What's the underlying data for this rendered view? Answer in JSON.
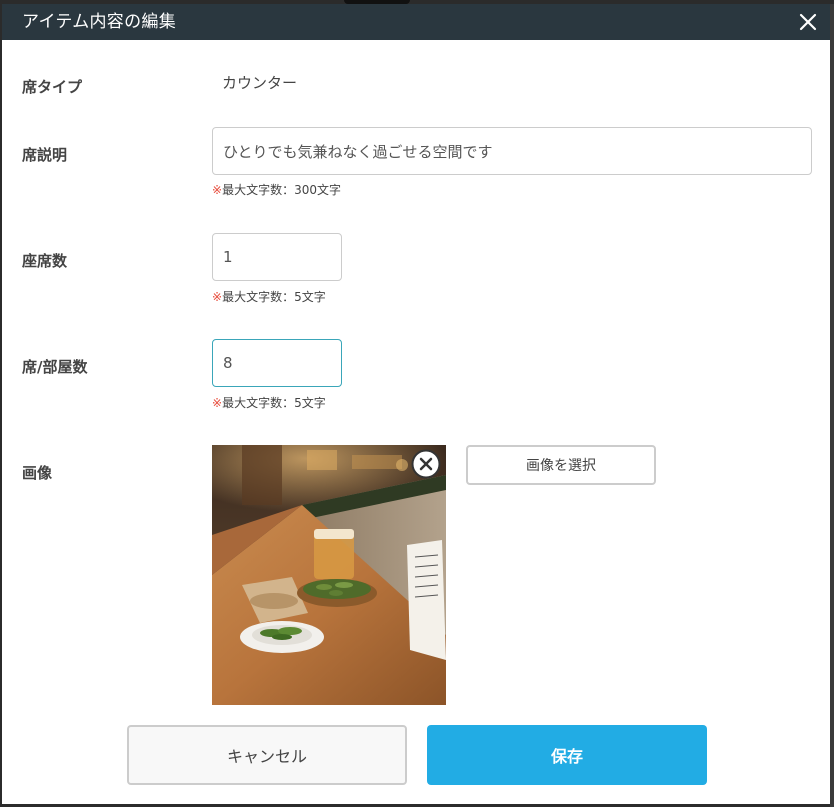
{
  "dialog": {
    "title": "アイテム内容の編集"
  },
  "fields": {
    "seat_type": {
      "label": "席タイプ",
      "value": "カウンター"
    },
    "seat_description": {
      "label": "席説明",
      "value": "ひとりでも気兼ねなく過ごせる空間です",
      "hint_mark": "※",
      "hint": "最大文字数：300文字"
    },
    "seat_count": {
      "label": "座席数",
      "value": "1",
      "hint_mark": "※",
      "hint": "最大文字数：5文字"
    },
    "room_count": {
      "label": "席/部屋数",
      "value": "8",
      "hint_mark": "※",
      "hint": "最大文字数：5文字"
    },
    "image": {
      "label": "画像",
      "select_button": "画像を選択"
    }
  },
  "footer": {
    "cancel_label": "キャンセル",
    "save_label": "保存"
  },
  "colors": {
    "header_bg": "#2a373f",
    "primary": "#22ace4",
    "focus_border": "#3aa6b9",
    "hint_mark": "#e74c3c"
  }
}
